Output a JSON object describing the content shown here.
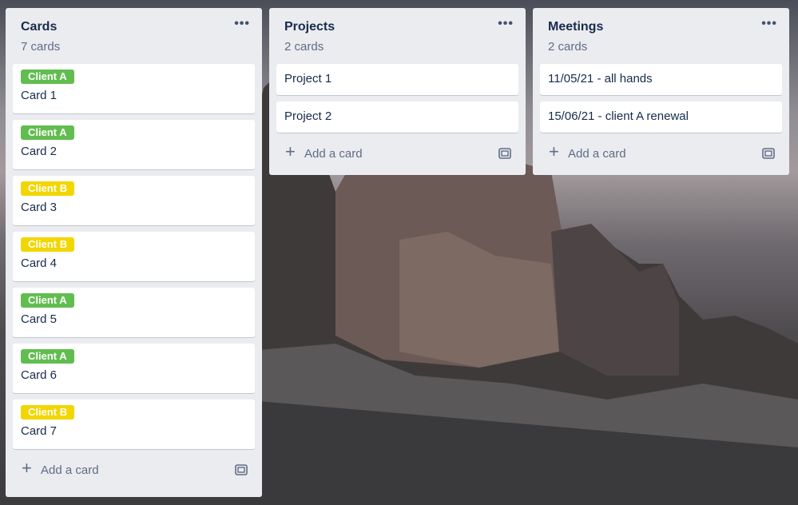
{
  "lists": [
    {
      "title": "Cards",
      "count": "7 cards",
      "cards": [
        {
          "label": "Client A",
          "label_color": "#61bd4f",
          "title": "Card 1"
        },
        {
          "label": "Client A",
          "label_color": "#61bd4f",
          "title": "Card 2"
        },
        {
          "label": "Client B",
          "label_color": "#f2d600",
          "title": "Card 3"
        },
        {
          "label": "Client B",
          "label_color": "#f2d600",
          "title": "Card 4"
        },
        {
          "label": "Client A",
          "label_color": "#61bd4f",
          "title": "Card 5"
        },
        {
          "label": "Client A",
          "label_color": "#61bd4f",
          "title": "Card 6"
        },
        {
          "label": "Client B",
          "label_color": "#f2d600",
          "title": "Card 7"
        }
      ],
      "add_label": "Add a card"
    },
    {
      "title": "Projects",
      "count": "2 cards",
      "cards": [
        {
          "title": "Project 1"
        },
        {
          "title": "Project 2"
        }
      ],
      "add_label": "Add a card"
    },
    {
      "title": "Meetings",
      "count": "2 cards",
      "cards": [
        {
          "title": "11/05/21 - all hands"
        },
        {
          "title": "15/06/21 - client A renewal"
        }
      ],
      "add_label": "Add a card"
    }
  ],
  "icons": {
    "menu": "more-horizontal-icon",
    "add": "plus-icon",
    "template": "card-template-icon"
  },
  "colors": {
    "client_a": "#61bd4f",
    "client_b": "#f2d600",
    "list_bg": "#ebecf0"
  }
}
